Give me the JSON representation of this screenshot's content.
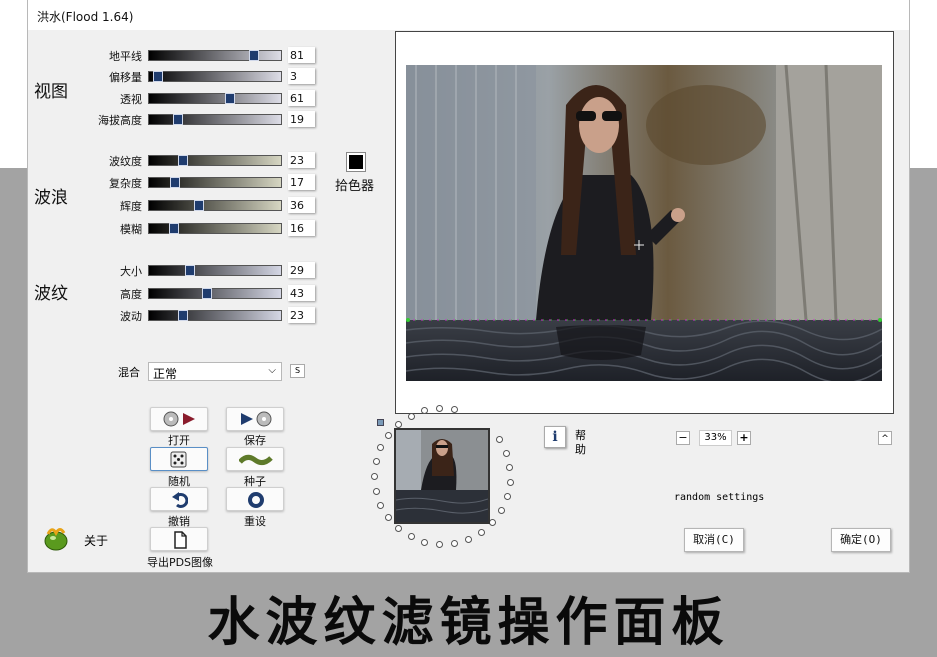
{
  "window": {
    "title": "洪水(Flood 1.64)"
  },
  "groups": {
    "view": {
      "label": "视图",
      "sliders": [
        {
          "label": "地平线",
          "value": "81",
          "fraction": 0.81
        },
        {
          "label": "偏移量",
          "value": "3",
          "fraction": 0.03
        },
        {
          "label": "透视",
          "value": "61",
          "fraction": 0.61
        },
        {
          "label": "海拔高度",
          "value": "19",
          "fraction": 0.19
        }
      ]
    },
    "waves": {
      "label": "波浪",
      "sliders": [
        {
          "label": "波纹度",
          "value": "23",
          "fraction": 0.23
        },
        {
          "label": "复杂度",
          "value": "17",
          "fraction": 0.17
        },
        {
          "label": "辉度",
          "value": "36",
          "fraction": 0.36
        },
        {
          "label": "模糊",
          "value": "16",
          "fraction": 0.16
        }
      ]
    },
    "ripple": {
      "label": "波纹",
      "sliders": [
        {
          "label": "大小",
          "value": "29",
          "fraction": 0.29
        },
        {
          "label": "高度",
          "value": "43",
          "fraction": 0.43
        },
        {
          "label": "波动",
          "value": "23",
          "fraction": 0.23
        }
      ]
    }
  },
  "color_picker": {
    "label": "拾色器",
    "color": "#000000"
  },
  "blend": {
    "label": "混合",
    "value": "正常",
    "s_button": "S"
  },
  "buttons": {
    "open": "打开",
    "save": "保存",
    "random": "随机",
    "seed": "种子",
    "undo": "撤销",
    "reset": "重设",
    "export": "导出PDS图像",
    "about": "关于"
  },
  "help": {
    "label_1": "帮",
    "label_2": "助",
    "icon": "i"
  },
  "zoom": {
    "minus": "−",
    "value": "33%",
    "plus": "+"
  },
  "collapse": "^",
  "random_settings": "random settings",
  "dialog": {
    "cancel": "取消(C)",
    "ok": "确定(O)"
  },
  "caption": "水波纹滤镜操作面板",
  "colors": {
    "accent": "#1f3c6e",
    "frame": "#444444"
  }
}
